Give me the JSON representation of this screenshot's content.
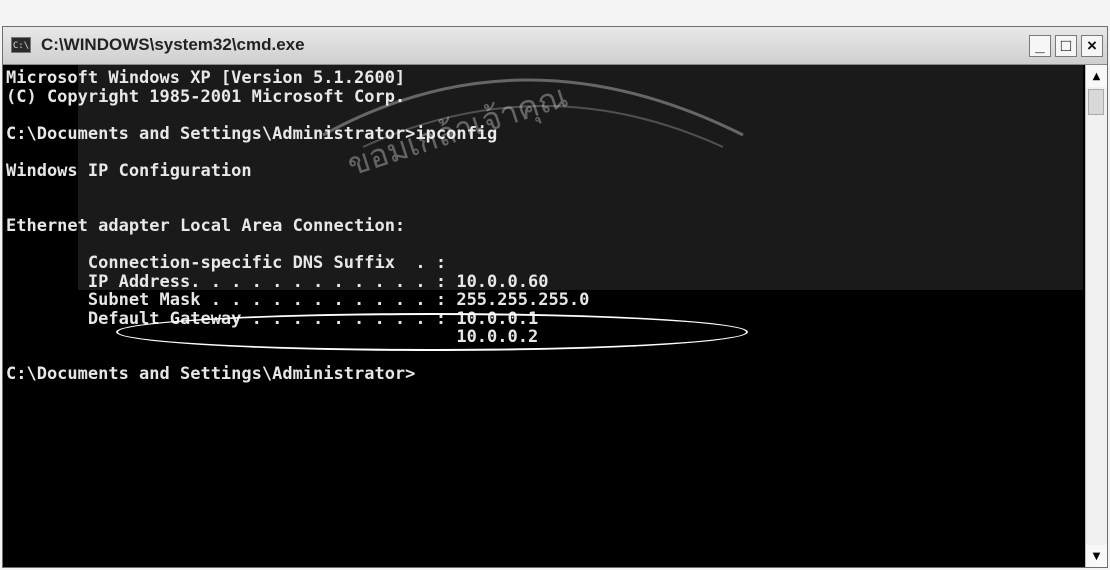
{
  "window": {
    "title": "C:\\WINDOWS\\system32\\cmd.exe",
    "icon_text": "C:\\",
    "minimize_label": "_",
    "maximize_label": "□",
    "close_label": "×"
  },
  "watermark": {
    "text": "ขอมเกล้าเจ้าคุณ"
  },
  "console": {
    "lines": [
      "Microsoft Windows XP [Version 5.1.2600]",
      "(C) Copyright 1985-2001 Microsoft Corp.",
      "",
      "C:\\Documents and Settings\\Administrator>ipconfig",
      "",
      "Windows IP Configuration",
      "",
      "",
      "Ethernet adapter Local Area Connection:",
      "",
      "        Connection-specific DNS Suffix  . :",
      "        IP Address. . . . . . . . . . . . : 10.0.0.60",
      "        Subnet Mask . . . . . . . . . . . : 255.255.255.0",
      "        Default Gateway . . . . . . . . . : 10.0.0.1",
      "                                            10.0.0.2",
      "",
      "C:\\Documents and Settings\\Administrator>"
    ]
  },
  "scrollbar": {
    "up_arrow": "▲",
    "down_arrow": "▼"
  }
}
